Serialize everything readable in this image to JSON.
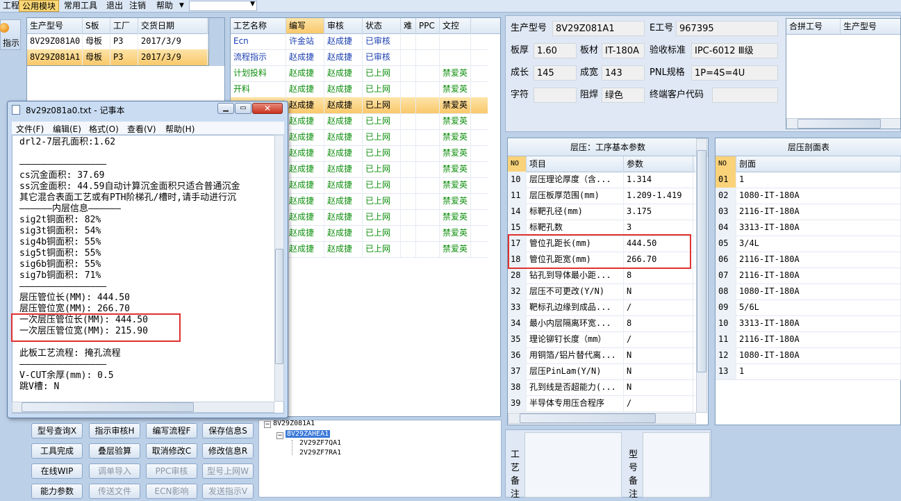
{
  "menubar": {
    "items": [
      "工程",
      "公用模块",
      "常用工具",
      "退出",
      "注销",
      "帮助"
    ],
    "active": "公用模块"
  },
  "left_toolbar": {
    "label": "指示"
  },
  "model_grid": {
    "headers": [
      "生产型号",
      "S板",
      "工厂",
      "交货日期"
    ],
    "rows": [
      [
        "8V29Z081A0",
        "母板",
        "P3",
        "2017/3/9"
      ],
      [
        "8V29Z081A1",
        "母板",
        "P3",
        "2017/3/9"
      ]
    ]
  },
  "process_grid": {
    "headers": [
      "工艺名称",
      "编写",
      "审核",
      "状态",
      "难",
      "PPC",
      "文控"
    ],
    "rows": [
      [
        "Ecn",
        "许金站",
        "赵成捷",
        "已审核",
        "",
        "",
        ""
      ],
      [
        "流程指示",
        "赵成捷",
        "赵成捷",
        "已审核",
        "",
        "",
        ""
      ],
      [
        "计划投料",
        "赵成捷",
        "赵成捷",
        "已上网",
        "",
        "",
        "禁爱英"
      ],
      [
        "开料",
        "赵成捷",
        "赵成捷",
        "已上网",
        "",
        "",
        "禁爱英"
      ],
      [
        "",
        "赵成捷",
        "赵成捷",
        "已上网",
        "",
        "",
        "禁爱英"
      ],
      [
        "",
        "赵成捷",
        "赵成捷",
        "已上网",
        "",
        "",
        "禁爱英"
      ],
      [
        "",
        "赵成捷",
        "赵成捷",
        "已上网",
        "",
        "",
        "禁爱英"
      ],
      [
        "",
        "赵成捷",
        "赵成捷",
        "已上网",
        "",
        "",
        "禁爱英"
      ],
      [
        "",
        "赵成捷",
        "赵成捷",
        "已上网",
        "",
        "",
        "禁爱英"
      ],
      [
        "",
        "赵成捷",
        "赵成捷",
        "已上网",
        "",
        "",
        "禁爱英"
      ],
      [
        "",
        "赵成捷",
        "赵成捷",
        "已上网",
        "",
        "",
        "禁爱英"
      ],
      [
        "",
        "赵成捷",
        "赵成捷",
        "已上网",
        "",
        "",
        "禁爱英"
      ],
      [
        "",
        "赵成捷",
        "赵成捷",
        "已上网",
        "",
        "",
        "禁爱英"
      ],
      [
        "",
        "赵成捷",
        "赵成捷",
        "已上网",
        "",
        "",
        "禁爱英"
      ]
    ]
  },
  "info": {
    "model_label": "生产型号",
    "model_value": "8V29Z081A1",
    "e_label": "E工号",
    "e_value": "967395",
    "thickness_label": "板厚",
    "thickness_value": "1.60",
    "material_label": "板材",
    "material_value": "IT-180A",
    "standard_label": "验收标准",
    "standard_value": "IPC-6012 Ⅲ级",
    "length_label": "成长",
    "length_value": "145",
    "width_label": "成宽",
    "width_value": "143",
    "pnl_label": "PNL规格",
    "pnl_value": "1P=4S=4U",
    "char_label": "字符",
    "char_value": "",
    "mask_label": "阻焊",
    "mask_value": "绿色",
    "customer_label": "终端客户代码",
    "customer_value": ""
  },
  "merge_grid": {
    "headers": [
      "合拼工号",
      "生产型号"
    ]
  },
  "lamination_params": {
    "title": "层压：工序基本参数",
    "headers": [
      "NO",
      "项目",
      "参数"
    ],
    "rows": [
      [
        "10",
        "层压理论厚度（含...",
        "1.314"
      ],
      [
        "11",
        "层压板厚范围(mm)",
        "1.209-1.419"
      ],
      [
        "14",
        "标靶孔径(mm)",
        "3.175"
      ],
      [
        "15",
        "标靶孔数",
        "3"
      ],
      [
        "17",
        "管位孔距长(mm)",
        "444.50"
      ],
      [
        "18",
        "管位孔距宽(mm)",
        "266.70"
      ],
      [
        "28",
        "钻孔到导体最小距...",
        "8"
      ],
      [
        "32",
        "层压不可更改(Y/N)",
        "N"
      ],
      [
        "33",
        "靶标孔边缘到成品...",
        "/"
      ],
      [
        "34",
        "最小内层隔离环宽...",
        "8"
      ],
      [
        "35",
        "理论铆钉长度（mm）",
        "/"
      ],
      [
        "36",
        "用铜箔/铝片替代离...",
        "N"
      ],
      [
        "37",
        "层压PinLam(Y/N)",
        "N"
      ],
      [
        "38",
        "孔到线是否超能力(...",
        "N"
      ],
      [
        "39",
        "半导体专用压合程序",
        "/"
      ]
    ]
  },
  "stackup": {
    "title": "层压剖面表",
    "headers": [
      "NO",
      "剖面"
    ],
    "rows": [
      [
        "01",
        "1"
      ],
      [
        "02",
        "1080-IT-180A"
      ],
      [
        "03",
        "2116-IT-180A"
      ],
      [
        "04",
        "3313-IT-180A"
      ],
      [
        "05",
        "3/4L"
      ],
      [
        "06",
        "2116-IT-180A"
      ],
      [
        "07",
        "2116-IT-180A"
      ],
      [
        "08",
        "1080-IT-180A"
      ],
      [
        "09",
        "5/6L"
      ],
      [
        "10",
        "3313-IT-180A"
      ],
      [
        "11",
        "2116-IT-180A"
      ],
      [
        "12",
        "1080-IT-180A"
      ],
      [
        "13",
        "1"
      ]
    ]
  },
  "notepad": {
    "title": "8v29z081a0.txt - 记事本",
    "menu": [
      "文件(F)",
      "编辑(E)",
      "格式(O)",
      "查看(V)",
      "帮助(H)"
    ],
    "lines": [
      "drl2-7层孔面积:1.62",
      "",
      "————————————————",
      "cs沉金面积: 37.69",
      "ss沉金面积: 44.59自动计算沉金面积只适合普通沉金",
      "其它混合表面工艺或有PTH阶梯孔/槽时,请手动进行沉",
      "——————内层信息——————",
      "sig2t铜面积: 82%",
      "sig3t铜面积: 54%",
      "sig4b铜面积: 55%",
      "sig5t铜面积: 55%",
      "sig6b铜面积: 55%",
      "sig7b铜面积: 71%",
      "————————————————",
      "层压管位长(MM): 444.50",
      "层压管位宽(MM): 266.70",
      "一次层压管位长(MM): 444.50",
      "一次层压管位宽(MM): 215.90",
      "",
      "此板工艺流程: 掩孔流程",
      "————————————————",
      "V-CUT余厚(mm): 0.5",
      "跳V槽: N"
    ]
  },
  "buttons": [
    {
      "label": "型号查询X",
      "enabled": true
    },
    {
      "label": "指示审核H",
      "enabled": true
    },
    {
      "label": "编写流程F",
      "enabled": true
    },
    {
      "label": "保存信息S",
      "enabled": true
    },
    {
      "label": "工具完成",
      "enabled": true
    },
    {
      "label": "叠层验算",
      "enabled": true
    },
    {
      "label": "取消修改C",
      "enabled": true
    },
    {
      "label": "修改信息R",
      "enabled": true
    },
    {
      "label": "在线WIP",
      "enabled": true
    },
    {
      "label": "调单导入",
      "enabled": false
    },
    {
      "label": "PPC审核",
      "enabled": false
    },
    {
      "label": "型号上网W",
      "enabled": false
    },
    {
      "label": "能力参数",
      "enabled": true
    },
    {
      "label": "传送文件",
      "enabled": false
    },
    {
      "label": "ECN影响",
      "enabled": false
    },
    {
      "label": "发送指示V",
      "enabled": false
    }
  ],
  "tree": {
    "root": "8V29Z081A1",
    "child": "8V29ZAHEA1",
    "leaves": [
      "2V29ZF7QA1",
      "2V29ZF7RA1"
    ]
  },
  "remarks": {
    "process_label": "工艺备注",
    "model_label": "型号备注"
  }
}
